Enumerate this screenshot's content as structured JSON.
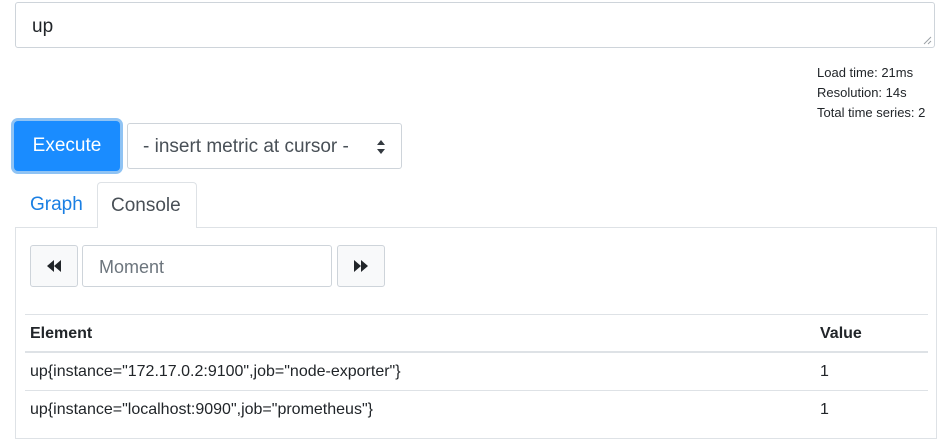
{
  "expression": {
    "value": "up"
  },
  "stats": {
    "load_time": "Load time: 21ms",
    "resolution": "Resolution: 14s",
    "total_series": "Total time series: 2"
  },
  "execute_label": "Execute",
  "metric_select": {
    "selected": "- insert metric at cursor -"
  },
  "tabs": [
    {
      "label": "Graph",
      "active": false
    },
    {
      "label": "Console",
      "active": true
    }
  ],
  "console": {
    "moment_placeholder": "Moment",
    "table": {
      "headers": [
        "Element",
        "Value"
      ],
      "rows": [
        {
          "element": "up{instance=\"172.17.0.2:9100\",job=\"node-exporter\"}",
          "value": "1"
        },
        {
          "element": "up{instance=\"localhost:9090\",job=\"prometheus\"}",
          "value": "1"
        }
      ]
    }
  },
  "colors": {
    "primary": "#1a8cff",
    "link": "#1a7fe3",
    "border": "#dee2e6"
  },
  "icons": [
    "resize-grip-icon",
    "select-arrows-icon",
    "fast-backward-icon",
    "fast-forward-icon"
  ]
}
